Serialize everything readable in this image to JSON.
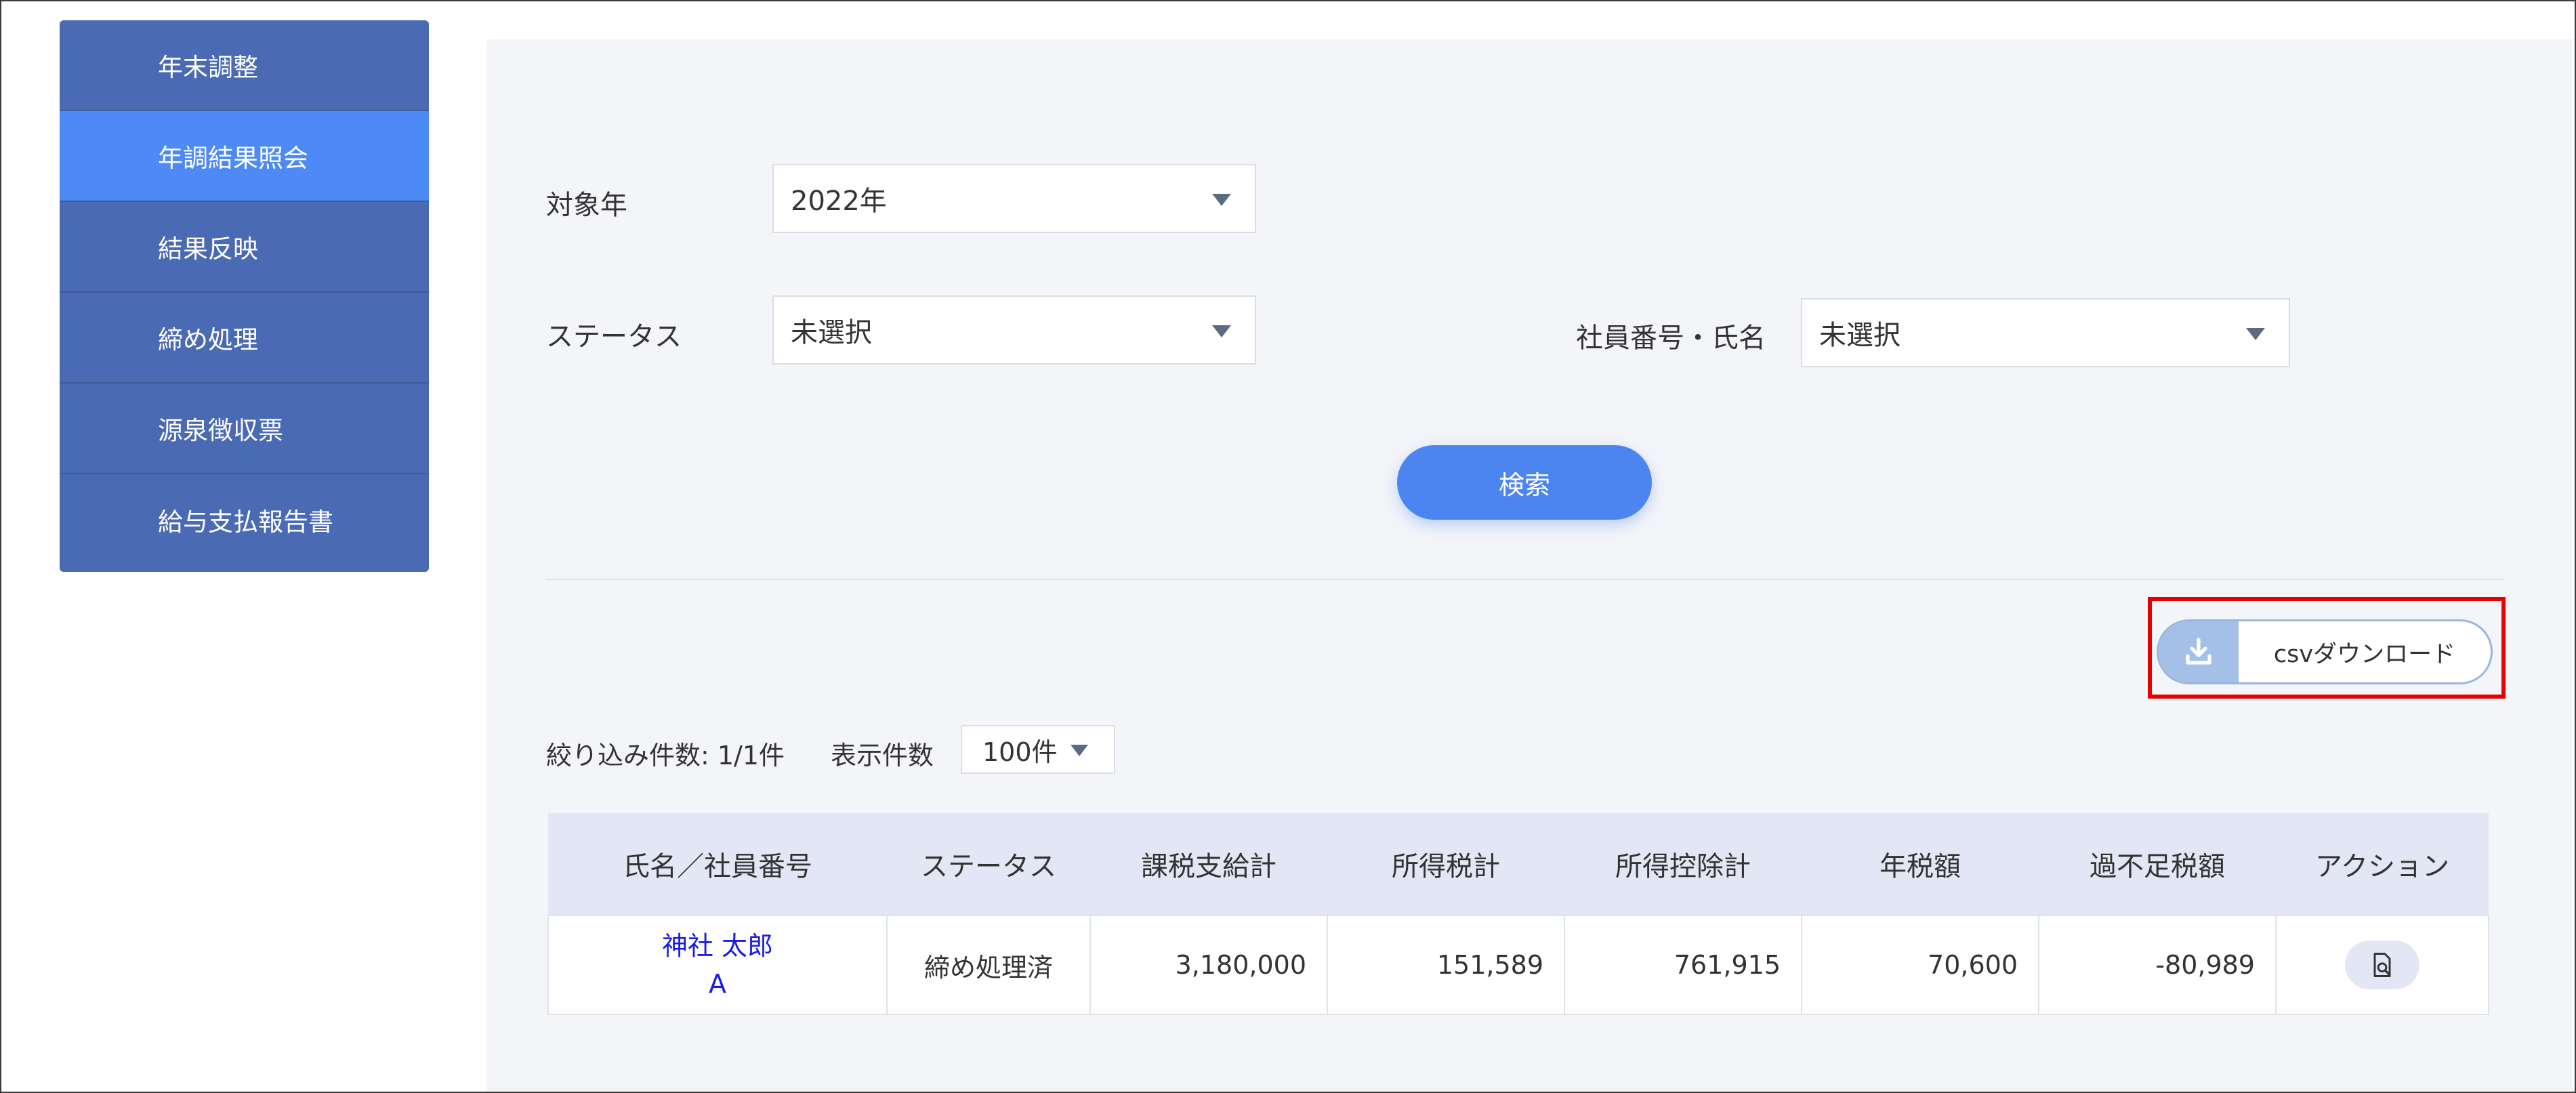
{
  "sidebar": {
    "items": [
      {
        "label": "年末調整"
      },
      {
        "label": "年調結果照会"
      },
      {
        "label": "結果反映"
      },
      {
        "label": "締め処理"
      },
      {
        "label": "源泉徴収票"
      },
      {
        "label": "給与支払報告書"
      }
    ],
    "active_index": 1
  },
  "filters": {
    "year_label": "対象年",
    "year_value": "2022年",
    "status_label": "ステータス",
    "status_value": "未選択",
    "employee_label": "社員番号・氏名",
    "employee_value": "未選択"
  },
  "search": {
    "button_label": "検索"
  },
  "csv": {
    "button_label": "csvダウンロード",
    "icon": "download-icon"
  },
  "results": {
    "count_text": "絞り込み件数: 1/1件",
    "per_page_label": "表示件数",
    "per_page_value": "100件"
  },
  "table": {
    "headers": [
      "氏名／社員番号",
      "ステータス",
      "課税支給計",
      "所得税計",
      "所得控除計",
      "年税額",
      "過不足税額",
      "アクション"
    ],
    "rows": [
      {
        "name": "神社 太郎",
        "employee_no": "A",
        "status": "締め処理済",
        "taxable_pay": "3,180,000",
        "income_tax": "151,589",
        "income_deduction": "761,915",
        "annual_tax": "70,600",
        "over_under_tax": "-80,989",
        "action_icon": "document-search-icon"
      }
    ]
  },
  "colors": {
    "sidebar_bg": "#4a6ab3",
    "sidebar_active": "#4d8af5",
    "primary_button": "#4d85f0",
    "highlight_box": "#e60000",
    "link": "#1a1ae6",
    "table_header_bg": "#e3e7f5"
  }
}
